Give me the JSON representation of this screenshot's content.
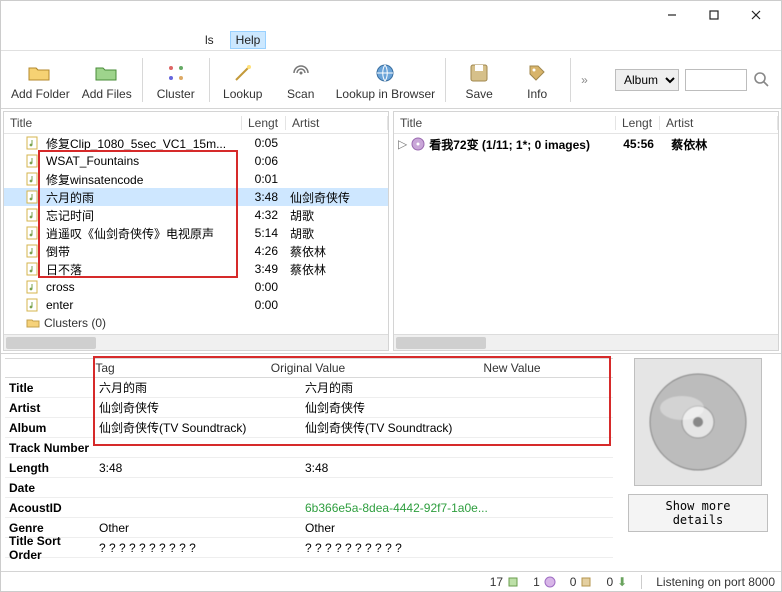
{
  "menu": {
    "ls": "ls",
    "help": "Help"
  },
  "toolbar": {
    "addFolder": "Add Folder",
    "addFiles": "Add Files",
    "cluster": "Cluster",
    "lookup": "Lookup",
    "scan": "Scan",
    "lib": "Lookup in Browser",
    "save": "Save",
    "info": "Info"
  },
  "search": {
    "mode": "Album",
    "placeholder": ""
  },
  "leftHead": {
    "title": "Title",
    "length": "Lengt",
    "artist": "Artist"
  },
  "rightHead": {
    "title": "Title",
    "length": "Lengt",
    "artist": "Artist"
  },
  "leftRows": [
    {
      "title": "修复Clip_1080_5sec_VC1_15m...",
      "len": "0:05",
      "artist": ""
    },
    {
      "title": "WSAT_Fountains",
      "len": "0:06",
      "artist": ""
    },
    {
      "title": "修复winsatencode",
      "len": "0:01",
      "artist": ""
    },
    {
      "title": "六月的雨",
      "len": "3:48",
      "artist": "仙剑奇侠传",
      "sel": true
    },
    {
      "title": "忘记时间",
      "len": "4:32",
      "artist": "胡歌"
    },
    {
      "title": "逍遥叹《仙剑奇侠传》电视原声",
      "len": "5:14",
      "artist": "胡歌"
    },
    {
      "title": "倒带",
      "len": "4:26",
      "artist": "蔡依林"
    },
    {
      "title": "日不落",
      "len": "3:49",
      "artist": "蔡依林"
    },
    {
      "title": "cross",
      "len": "0:00",
      "artist": ""
    },
    {
      "title": "enter",
      "len": "0:00",
      "artist": ""
    }
  ],
  "clusters": "Clusters (0)",
  "rightRow": {
    "title": "看我72变 (1/11; 1*; 0 images)",
    "len": "45:56",
    "artist": "蔡依林"
  },
  "tagHead": {
    "tag": "Tag",
    "ov": "Original Value",
    "nv": "New Value"
  },
  "tags": [
    {
      "label": "Title",
      "ov": "六月的雨",
      "nv": "六月的雨"
    },
    {
      "label": "Artist",
      "ov": "仙剑奇侠传",
      "nv": "仙剑奇侠传"
    },
    {
      "label": "Album",
      "ov": "仙剑奇侠传(TV Soundtrack)",
      "nv": "仙剑奇侠传(TV Soundtrack)"
    },
    {
      "label": "Track Number",
      "ov": "",
      "nv": ""
    },
    {
      "label": "Length",
      "ov": "3:48",
      "nv": "3:48"
    },
    {
      "label": "Date",
      "ov": "",
      "nv": ""
    },
    {
      "label": "AcoustID",
      "ov": "",
      "nv": "6b366e5a-8dea-4442-92f7-1a0e...",
      "green": true
    },
    {
      "label": "Genre",
      "ov": "Other",
      "nv": "Other"
    },
    {
      "label": "Title Sort Order",
      "ov": "? ? ? ? ? ? ? ? ? ?",
      "nv": "? ? ? ? ? ? ? ? ? ?"
    }
  ],
  "showMore": "Show more details",
  "status": {
    "a": "17",
    "b": "1",
    "c": "0",
    "d": "0",
    "listen": "Listening on port 8000"
  }
}
